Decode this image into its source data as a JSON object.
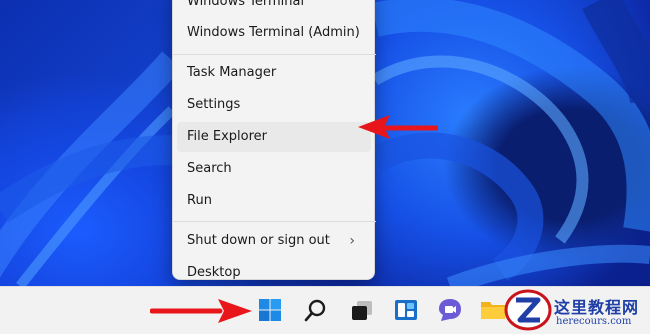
{
  "context_menu": {
    "items": [
      {
        "label": "Windows Terminal"
      },
      {
        "label": "Windows Terminal (Admin)"
      },
      {
        "label": "Task Manager"
      },
      {
        "label": "Settings"
      },
      {
        "label": "File Explorer"
      },
      {
        "label": "Search"
      },
      {
        "label": "Run"
      },
      {
        "label": "Shut down or sign out",
        "submenu_icon": "chevron-right-icon"
      },
      {
        "label": "Desktop"
      }
    ],
    "highlighted": "File Explorer"
  },
  "taskbar": {
    "icons": [
      "windows-start-icon",
      "search-icon",
      "task-view-icon",
      "widgets-icon",
      "teams-chat-icon",
      "file-explorer-icon"
    ]
  },
  "annotations": {
    "arrow_color": "#e8161b",
    "arrows": [
      "arrow-to-file-explorer",
      "arrow-to-start-button"
    ]
  },
  "watermark": {
    "title": "这里教程网",
    "url": "herecours.com"
  },
  "colors": {
    "menu_bg": "#f3f3f3",
    "taskbar_bg": "#f2f2f2",
    "start_blue": "#1f8ae6"
  }
}
